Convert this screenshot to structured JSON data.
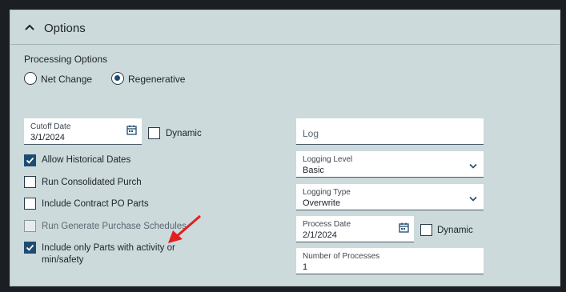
{
  "panel": {
    "header_title": "Options",
    "colors": {
      "background": "#ccdadc",
      "accent": "#1e4c70",
      "arrow": "#e02020"
    }
  },
  "processing": {
    "label": "Processing Options",
    "options": [
      {
        "label": "Net Change",
        "selected": false
      },
      {
        "label": "Regenerative",
        "selected": true
      }
    ]
  },
  "left": {
    "cutoff_date": {
      "label": "Cutoff Date",
      "value": "3/1/2024",
      "icon": "calendar-icon"
    },
    "cutoff_dynamic": {
      "label": "Dynamic",
      "checked": false
    },
    "checkboxes": [
      {
        "label": "Allow Historical Dates",
        "checked": true,
        "disabled": false
      },
      {
        "label": "Run Consolidated Purch",
        "checked": false,
        "disabled": false
      },
      {
        "label": "Include Contract PO Parts",
        "checked": false,
        "disabled": false
      },
      {
        "label": "Run Generate Purchase Schedules",
        "checked": false,
        "disabled": true
      },
      {
        "label": "Include only Parts with activity or",
        "label2": "min/safety",
        "checked": true,
        "disabled": false
      }
    ]
  },
  "right": {
    "log": {
      "placeholder": "Log"
    },
    "logging_level": {
      "label": "Logging Level",
      "value": "Basic"
    },
    "logging_type": {
      "label": "Logging Type",
      "value": "Overwrite"
    },
    "process_date": {
      "label": "Process Date",
      "value": "2/1/2024",
      "icon": "calendar-icon"
    },
    "process_dynamic": {
      "label": "Dynamic",
      "checked": false
    },
    "number_of_processes": {
      "label": "Number of Processes",
      "value": "1"
    }
  }
}
